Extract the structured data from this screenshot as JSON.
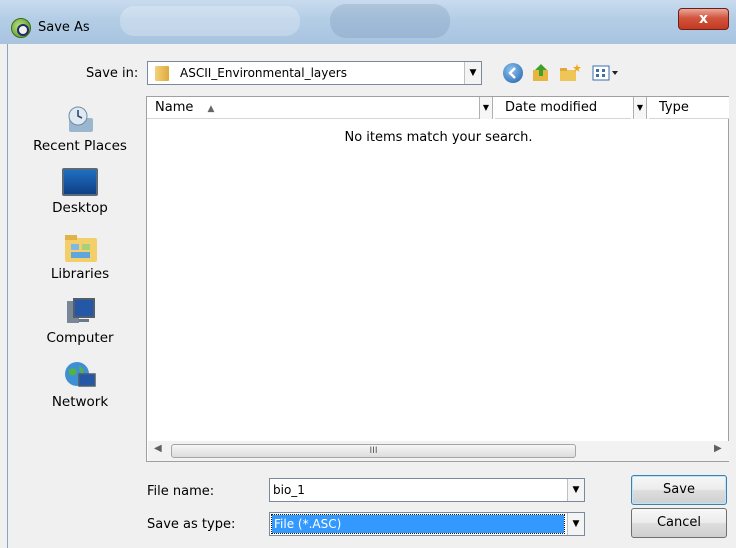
{
  "window": {
    "title": "Save As",
    "close_glyph": "x"
  },
  "save_in": {
    "label": "Save in:",
    "value": "ASCII_Environmental_layers"
  },
  "toolbar": {
    "icons": [
      "back-icon",
      "up-folder-icon",
      "new-folder-icon",
      "view-menu-icon"
    ]
  },
  "places": [
    {
      "label": "Recent Places",
      "icon": "recent-places-icon"
    },
    {
      "label": "Desktop",
      "icon": "desktop-icon"
    },
    {
      "label": "Libraries",
      "icon": "libraries-icon"
    },
    {
      "label": "Computer",
      "icon": "computer-icon"
    },
    {
      "label": "Network",
      "icon": "network-icon"
    }
  ],
  "file_list": {
    "columns": [
      "Name",
      "Date modified",
      "Type"
    ],
    "sort_glyph": "▲",
    "empty_message": "No items match your search.",
    "scroll_grip": "III"
  },
  "file_name": {
    "label": "File name:",
    "value": "bio_1"
  },
  "save_type": {
    "label": "Save as type:",
    "value": "File (*.ASC)"
  },
  "buttons": {
    "save": "Save",
    "cancel": "Cancel"
  },
  "colors": {
    "selection": "#3399ff",
    "close_button": "#c8412a"
  }
}
